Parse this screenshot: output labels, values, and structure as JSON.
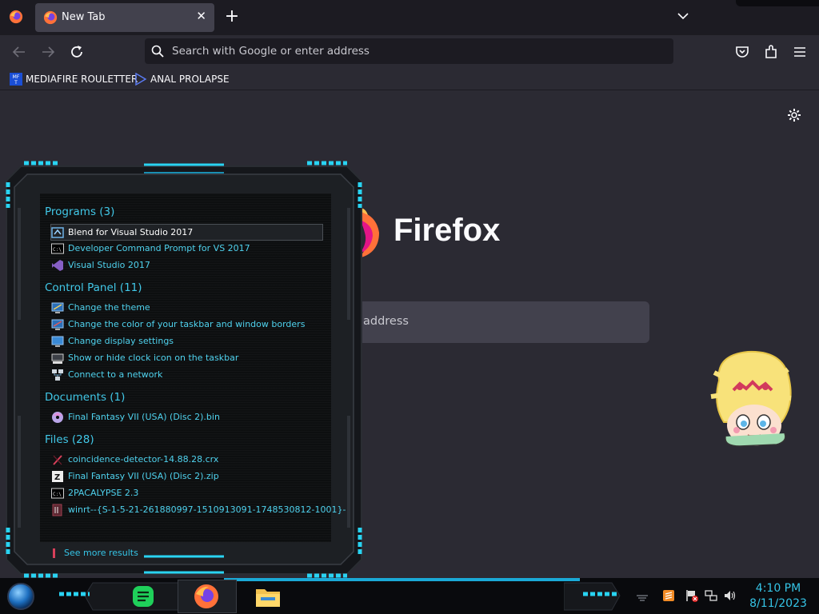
{
  "browser": {
    "tab": {
      "title": "New Tab"
    },
    "urlbar": {
      "placeholder": "Search with Google or enter address"
    },
    "bookmarks": [
      {
        "label": "MEDIAFIRE ROULETTER",
        "icon": "mediafire-icon"
      },
      {
        "label": "ANAL PROLAPSE",
        "icon": "sigma-icon"
      }
    ],
    "newtab": {
      "brand": "Firefox",
      "search_placeholder_visible": "address"
    }
  },
  "startmenu": {
    "sections": [
      {
        "heading": "Programs (3)",
        "items": [
          {
            "label": "Blend for Visual Studio 2017",
            "icon": "blend-icon",
            "selected": true
          },
          {
            "label": "Developer Command Prompt for VS 2017",
            "icon": "cmd-icon"
          },
          {
            "label": "Visual Studio 2017",
            "icon": "visual-studio-icon"
          }
        ]
      },
      {
        "heading": "Control Panel (11)",
        "items": [
          {
            "label": "Change the theme",
            "icon": "theme-icon"
          },
          {
            "label": "Change the color of your taskbar and window borders",
            "icon": "color-icon"
          },
          {
            "label": "Change display settings",
            "icon": "display-icon"
          },
          {
            "label": "Show or hide clock icon on the taskbar",
            "icon": "clock-settings-icon"
          },
          {
            "label": "Connect to a network",
            "icon": "network-icon"
          }
        ]
      },
      {
        "heading": "Documents (1)",
        "items": [
          {
            "label": "Final Fantasy VII (USA) (Disc 2).bin",
            "icon": "disc-image-icon"
          }
        ]
      },
      {
        "heading": "Files (28)",
        "items": [
          {
            "label": "coincidence-detector-14.88.28.crx",
            "icon": "crx-file-icon"
          },
          {
            "label": "Final Fantasy VII (USA) (Disc 2).zip",
            "icon": "zip-file-icon"
          },
          {
            "label": "2PACALYPSE 2.3",
            "icon": "cmd-icon"
          },
          {
            "label": "winrt--{S-1-5-21-261880997-1510913091-1748530812-1001}-",
            "icon": "file-icon"
          }
        ]
      }
    ],
    "see_more": "See more results"
  },
  "taskbar": {
    "apps": [
      "notes-icon",
      "firefox-icon",
      "file-explorer-icon"
    ],
    "tray": [
      "sublime-icon",
      "action-center-flag-icon",
      "network-status-icon",
      "volume-icon"
    ],
    "time": "4:10 PM",
    "date": "8/11/2023"
  },
  "colors": {
    "browser_bg": "#2b2a33",
    "tabstrip_bg": "#1c1b22",
    "accent_cyan": "#35c4e6",
    "taskbar_bg": "#090a0d"
  }
}
